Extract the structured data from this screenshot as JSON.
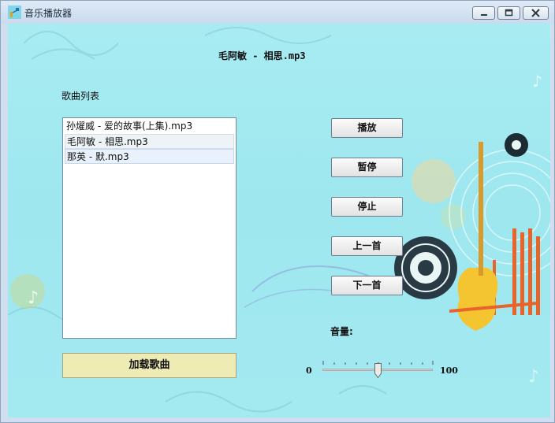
{
  "window": {
    "title": "音乐播放器",
    "accent": "#a3e9f0"
  },
  "player": {
    "now_playing": "毛阿敏 - 相思.mp3",
    "list_label": "歌曲列表"
  },
  "playlist": {
    "items": [
      {
        "label": "孙燿威 - 爱的故事(上集).mp3",
        "state": "normal"
      },
      {
        "label": "毛阿敏 - 相思.mp3",
        "state": "hover"
      },
      {
        "label": "那英 - 默.mp3",
        "state": "selected"
      }
    ]
  },
  "controls": {
    "play_label": "播放",
    "pause_label": "暂停",
    "stop_label": "停止",
    "prev_label": "上一首",
    "next_label": "下一首",
    "load_label": "加载歌曲"
  },
  "volume": {
    "label": "音量:",
    "min_label": "0",
    "max_label": "100",
    "value": 50,
    "min": 0,
    "max": 100
  }
}
